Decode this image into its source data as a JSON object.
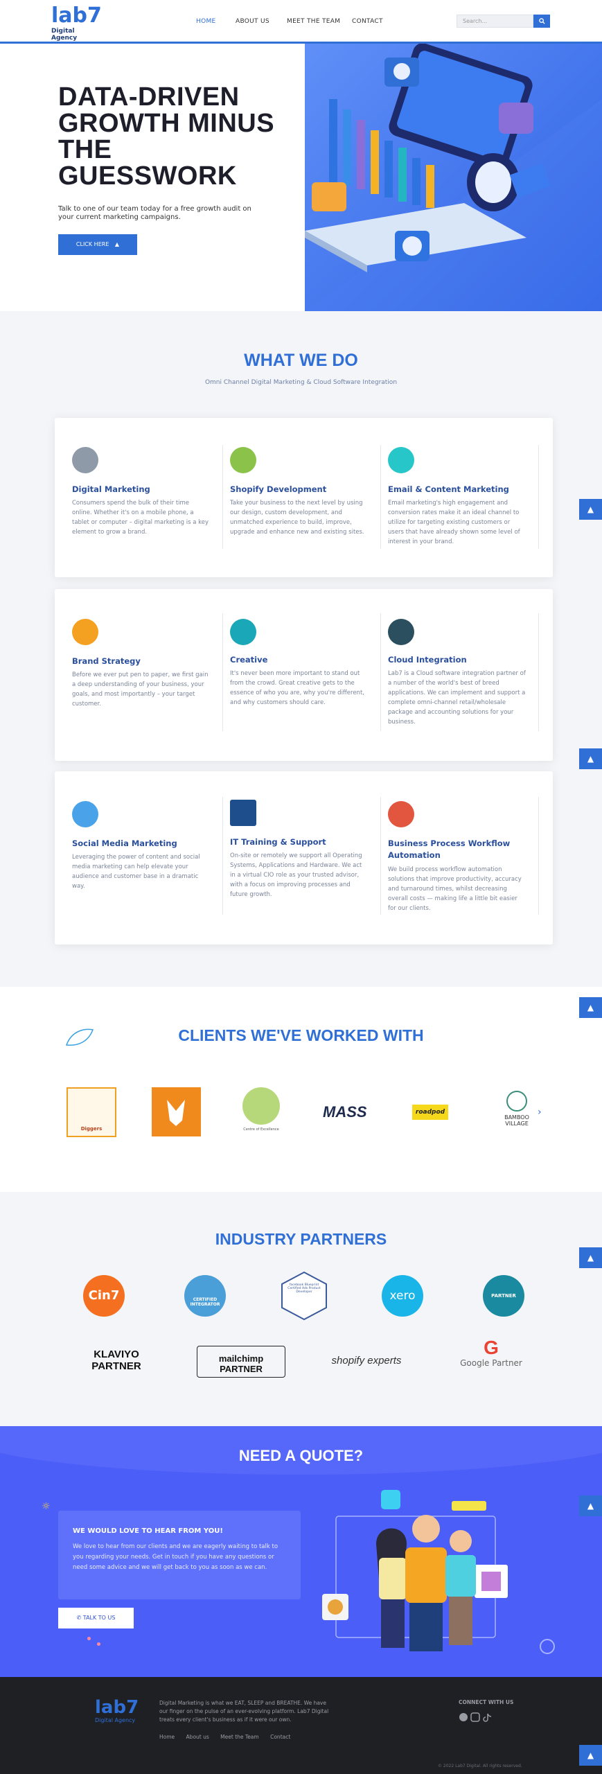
{
  "header": {
    "logo_mark": "lab7",
    "logo_sub": "Digital Agency",
    "nav": [
      "HOME",
      "ABOUT US",
      "MEET THE TEAM",
      "CONTACT"
    ],
    "search_placeholder": "Search...",
    "search_icon": "magnifier-icon"
  },
  "hero": {
    "title": "DATA-DRIVEN GROWTH MINUS THE GUESSWORK",
    "lead": "Talk to one of our team today for a free growth audit on your current marketing campaigns.",
    "button": "CLICK HERE"
  },
  "what_we_do": {
    "title": "WHAT WE DO",
    "subtitle": "Omni Channel Digital Marketing & Cloud Software Integration",
    "services": [
      {
        "title": "Digital Marketing",
        "desc": "Consumers spend the bulk of their time online. Whether it's on a mobile phone, a tablet or computer – digital marketing is a key element to grow a brand.",
        "icon": "chart-icon",
        "color": "#8e9aa8"
      },
      {
        "title": "Shopify Development",
        "desc": "Take your business to the next level by using our design, custom development, and unmatched experience to build, improve, upgrade and enhance new and existing sites.",
        "icon": "shopify-bag-icon",
        "color": "#8bc34a"
      },
      {
        "title": "Email & Content Marketing",
        "desc": "Email marketing's high engagement and conversion rates make it an ideal channel to utilize for targeting existing customers or users that have already shown some level of interest in your brand.",
        "icon": "email-icon",
        "color": "#26c6c9"
      },
      {
        "title": "Brand Strategy",
        "desc": "Before we ever put pen to paper, we first gain a deep understanding of your business, your goals, and most importantly – your target customer.",
        "icon": "megaphone-icon",
        "color": "#f4a020"
      },
      {
        "title": "Creative",
        "desc": "It's never been more important to stand out from the crowd. Great creative gets to the essence of who you are, why you're different, and why customers should care.",
        "icon": "magnifier-icon",
        "color": "#1aa7b8"
      },
      {
        "title": "Cloud Integration",
        "desc": "Lab7 is a Cloud software integration partner of a number of the world's best of breed applications. We can implement and support a complete omni-channel retail/wholesale package and accounting solutions for your business.",
        "icon": "cloud-icon",
        "color": "#2b4f5e"
      },
      {
        "title": "Social Media Marketing",
        "desc": "Leveraging the power of content and social media marketing can help elevate your audience and customer base in a dramatic way.",
        "icon": "social-share-icon",
        "color": "#4aa3e8"
      },
      {
        "title": "IT Training & Support",
        "desc": "On-site or remotely we support all Operating Systems, Applications and Hardware. We act in a virtual CIO role as your trusted advisor, with a focus on improving processes and future growth.",
        "icon": "monitor-icon",
        "color": "#1e4f8c"
      },
      {
        "title": "Business Process Workflow Automation",
        "desc": "We build process workflow automation solutions that improve productivity, accuracy and turnaround times, whilst decreasing overall costs — making life a little bit easier for our clients.",
        "icon": "workflow-icon",
        "color": "#e2553e"
      }
    ]
  },
  "clients": {
    "title": "CLIENTS WE'VE WORKED WITH",
    "logos": [
      "Diggers",
      "Fox Head",
      "Centre of Excellence",
      "MASS",
      "roadpod",
      "BAMBOO VILLAGE"
    ]
  },
  "partners": {
    "title": "INDUSTRY PARTNERS",
    "logos": [
      "Cin7",
      "CERTIFIED INTEGRATOR",
      "facebook Blueprint Certified Ads Product Developer",
      "xero",
      "PARTNER",
      "KLAVIYO PARTNER",
      "mailchimp PARTNER",
      "shopify experts",
      "Google Partner"
    ]
  },
  "quote": {
    "title": "NEED A QUOTE?",
    "box_title": "WE WOULD LOVE TO HEAR FROM YOU!",
    "box_text": "We love to hear from our clients and we are eagerly waiting to talk to you regarding your needs. Get in touch if you have any questions or need some advice and we will get back to you as soon as we can.",
    "button": "TALK TO US"
  },
  "footer": {
    "logo_mark": "lab7",
    "logo_sub": "Digital Agency",
    "about": "Digital Marketing is what we EAT, SLEEP and BREATHE. We have our finger on the pulse of an ever-evolving platform. Lab7 Digital treats every client's business as if it were our own.",
    "links": [
      "Home",
      "About us",
      "Meet the Team",
      "Contact"
    ],
    "connect": "CONNECT WITH US",
    "social": [
      "facebook-icon",
      "instagram-icon",
      "tiktok-icon"
    ],
    "copyright": "© 2022 Lab7 Digital. All rights reserved."
  },
  "colors": {
    "brand": "#2f6fd6",
    "quote_bg": "#4c5ef8",
    "footer_bg": "#1f2024"
  }
}
